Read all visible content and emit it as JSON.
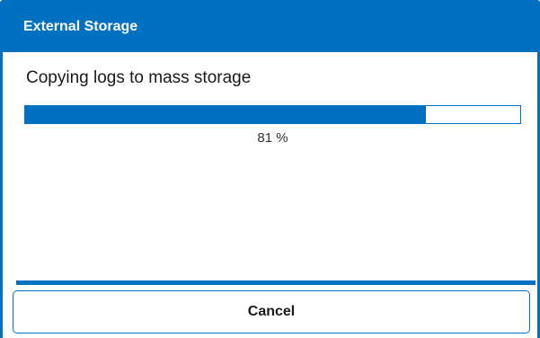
{
  "dialog": {
    "title": "External Storage",
    "message": "Copying logs to mass storage",
    "progress": {
      "value": 0.81,
      "label": "81 %"
    },
    "cancel_label": "Cancel"
  },
  "colors": {
    "accent": "#0070c0",
    "background": "#ffffff",
    "text": "#1a1a1a"
  }
}
